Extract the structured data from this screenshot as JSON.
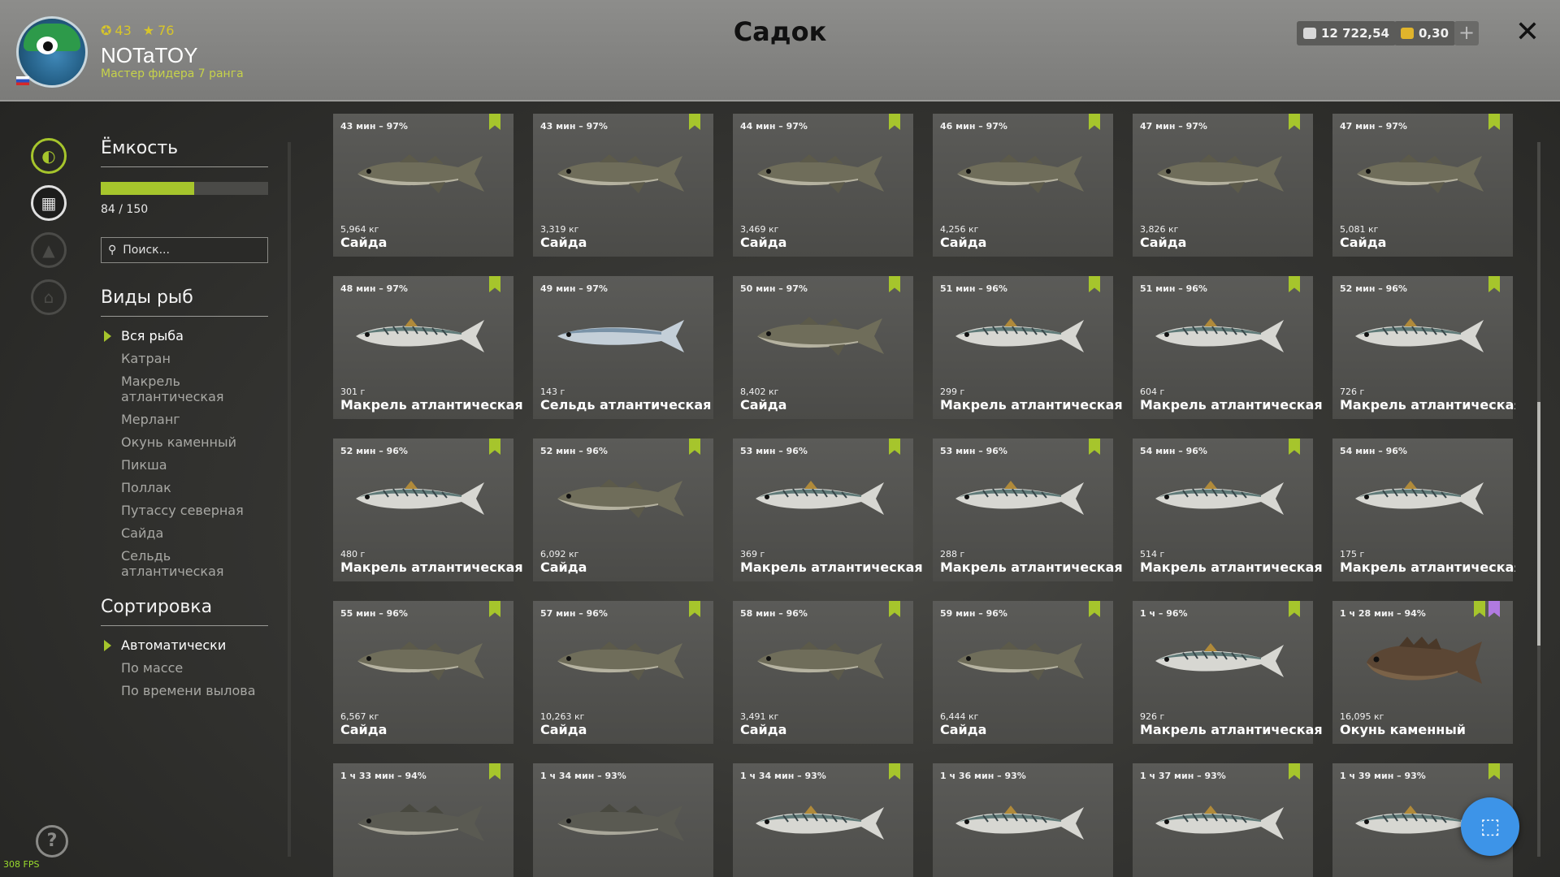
{
  "header": {
    "title": "Садок",
    "player": {
      "name": "NOTaTOY",
      "rank": "Мастер фидера 7 ранга",
      "level": "43",
      "stars": "76"
    },
    "silver": "12 722,54",
    "gold": "0,30",
    "plus": "+",
    "close": "✕"
  },
  "sidebar": {
    "capacity_title": "Ёмкость",
    "capacity_value": 84,
    "capacity_max": 150,
    "capacity_text": "84 / 150",
    "search_placeholder": "Поиск...",
    "species_title": "Виды рыб",
    "species": [
      {
        "label": "Вся рыба",
        "selected": true
      },
      {
        "label": "Катран",
        "selected": false
      },
      {
        "label": "Макрель атлантическая",
        "selected": false
      },
      {
        "label": "Мерланг",
        "selected": false
      },
      {
        "label": "Окунь каменный",
        "selected": false
      },
      {
        "label": "Пикша",
        "selected": false
      },
      {
        "label": "Поллак",
        "selected": false
      },
      {
        "label": "Путассу северная",
        "selected": false
      },
      {
        "label": "Сайда",
        "selected": false
      },
      {
        "label": "Сельдь атлантическая",
        "selected": false
      }
    ],
    "sort_title": "Сортировка",
    "sort_options": [
      {
        "label": "Автоматически",
        "selected": true
      },
      {
        "label": "По массе",
        "selected": false
      },
      {
        "label": "По времени вылова",
        "selected": false
      }
    ]
  },
  "fps": "308 FPS",
  "fish": [
    {
      "time": "43 мин – 97%",
      "weight": "5,964 кг",
      "name": "Сайда",
      "kind": "saithe",
      "marks": [
        "green"
      ]
    },
    {
      "time": "43 мин – 97%",
      "weight": "3,319 кг",
      "name": "Сайда",
      "kind": "saithe",
      "marks": [
        "green"
      ]
    },
    {
      "time": "44 мин – 97%",
      "weight": "3,469 кг",
      "name": "Сайда",
      "kind": "saithe",
      "marks": [
        "green"
      ]
    },
    {
      "time": "46 мин – 97%",
      "weight": "4,256 кг",
      "name": "Сайда",
      "kind": "saithe",
      "marks": [
        "green"
      ]
    },
    {
      "time": "47 мин – 97%",
      "weight": "3,826 кг",
      "name": "Сайда",
      "kind": "saithe",
      "marks": [
        "green"
      ]
    },
    {
      "time": "47 мин – 97%",
      "weight": "5,081 кг",
      "name": "Сайда",
      "kind": "saithe",
      "marks": [
        "green"
      ]
    },
    {
      "time": "48 мин – 97%",
      "weight": "301 г",
      "name": "Макрель атлантическая",
      "kind": "mackerel",
      "marks": [
        "green"
      ]
    },
    {
      "time": "49 мин – 97%",
      "weight": "143 г",
      "name": "Сельдь атлантическая",
      "kind": "herring",
      "marks": []
    },
    {
      "time": "50 мин – 97%",
      "weight": "8,402 кг",
      "name": "Сайда",
      "kind": "saithe",
      "marks": [
        "green"
      ]
    },
    {
      "time": "51 мин – 96%",
      "weight": "299 г",
      "name": "Макрель атлантическая",
      "kind": "mackerel",
      "marks": [
        "green"
      ]
    },
    {
      "time": "51 мин – 96%",
      "weight": "604 г",
      "name": "Макрель атлантическая",
      "kind": "mackerel",
      "marks": [
        "green"
      ]
    },
    {
      "time": "52 мин – 96%",
      "weight": "726 г",
      "name": "Макрель атлантическая",
      "kind": "mackerel",
      "marks": [
        "green"
      ]
    },
    {
      "time": "52 мин – 96%",
      "weight": "480 г",
      "name": "Макрель атлантическая",
      "kind": "mackerel",
      "marks": [
        "green"
      ]
    },
    {
      "time": "52 мин – 96%",
      "weight": "6,092 кг",
      "name": "Сайда",
      "kind": "saithe",
      "marks": [
        "green"
      ]
    },
    {
      "time": "53 мин – 96%",
      "weight": "369 г",
      "name": "Макрель атлантическая",
      "kind": "mackerel",
      "marks": [
        "green"
      ]
    },
    {
      "time": "53 мин – 96%",
      "weight": "288 г",
      "name": "Макрель атлантическая",
      "kind": "mackerel",
      "marks": [
        "green"
      ]
    },
    {
      "time": "54 мин – 96%",
      "weight": "514 г",
      "name": "Макрель атлантическая",
      "kind": "mackerel",
      "marks": [
        "green"
      ]
    },
    {
      "time": "54 мин – 96%",
      "weight": "175 г",
      "name": "Макрель атлантическая",
      "kind": "mackerel",
      "marks": []
    },
    {
      "time": "55 мин – 96%",
      "weight": "6,567 кг",
      "name": "Сайда",
      "kind": "saithe",
      "marks": [
        "green"
      ]
    },
    {
      "time": "57 мин – 96%",
      "weight": "10,263 кг",
      "name": "Сайда",
      "kind": "saithe",
      "marks": [
        "green"
      ]
    },
    {
      "time": "58 мин – 96%",
      "weight": "3,491 кг",
      "name": "Сайда",
      "kind": "saithe",
      "marks": [
        "green"
      ]
    },
    {
      "time": "59 мин – 96%",
      "weight": "6,444 кг",
      "name": "Сайда",
      "kind": "saithe",
      "marks": [
        "green"
      ]
    },
    {
      "time": "1 ч – 96%",
      "weight": "926 г",
      "name": "Макрель атлантическая",
      "kind": "mackerel",
      "marks": [
        "green"
      ]
    },
    {
      "time": "1 ч 28 мин – 94%",
      "weight": "16,095 кг",
      "name": "Окунь каменный",
      "kind": "perch",
      "marks": [
        "green",
        "purple"
      ]
    },
    {
      "time": "1 ч 33 мин – 94%",
      "weight": "",
      "name": "",
      "kind": "pollack",
      "marks": [
        "green"
      ]
    },
    {
      "time": "1 ч 34 мин – 93%",
      "weight": "",
      "name": "",
      "kind": "pollack",
      "marks": []
    },
    {
      "time": "1 ч 34 мин – 93%",
      "weight": "",
      "name": "",
      "kind": "mackerel",
      "marks": [
        "green"
      ]
    },
    {
      "time": "1 ч 36 мин – 93%",
      "weight": "",
      "name": "",
      "kind": "mackerel",
      "marks": []
    },
    {
      "time": "1 ч 37 мин – 93%",
      "weight": "",
      "name": "",
      "kind": "mackerel",
      "marks": [
        "green"
      ]
    },
    {
      "time": "1 ч 39 мин – 93%",
      "weight": "",
      "name": "",
      "kind": "mackerel",
      "marks": [
        "green"
      ]
    }
  ],
  "colors": {
    "accent": "#a6c52c",
    "purple_mark": "#b07ae0",
    "topbar": "#858583"
  }
}
